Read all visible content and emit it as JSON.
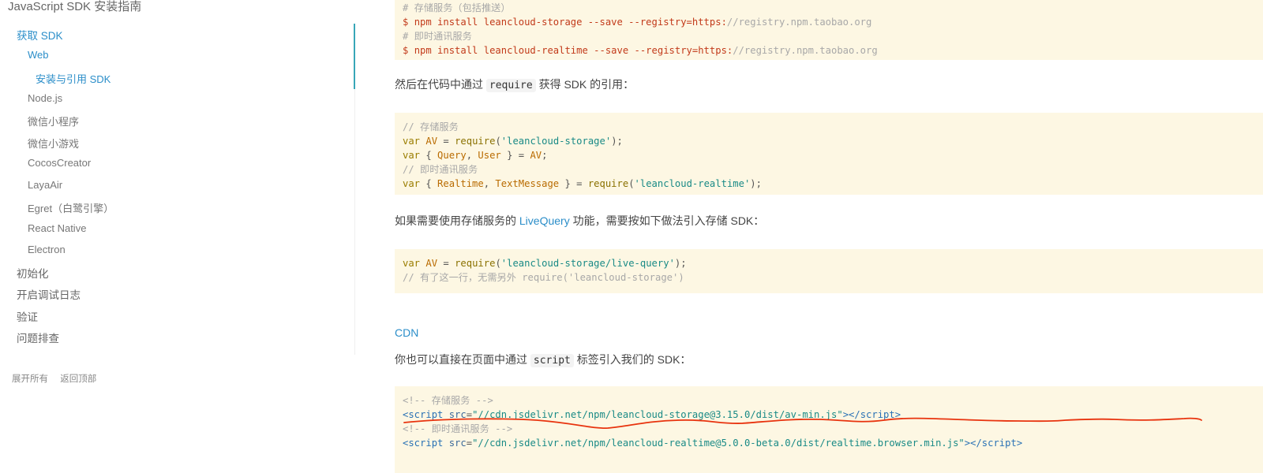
{
  "sidebar": {
    "title": "JavaScript SDK 安装指南",
    "items": [
      {
        "label": "获取 SDK"
      },
      {
        "label": "Web"
      },
      {
        "label": "安装与引用 SDK"
      },
      {
        "label": "Node.js"
      },
      {
        "label": "微信小程序"
      },
      {
        "label": "微信小游戏"
      },
      {
        "label": "CocosCreator"
      },
      {
        "label": "LayaAir"
      },
      {
        "label": "Egret（白鹭引擎）"
      },
      {
        "label": "React Native"
      },
      {
        "label": "Electron"
      },
      {
        "label": "初始化"
      },
      {
        "label": "开启调试日志"
      },
      {
        "label": "验证"
      },
      {
        "label": "问题排查"
      }
    ],
    "footer": {
      "expand_all": "展开所有",
      "back_to_top": "返回顶部"
    }
  },
  "code1": {
    "comment1": "# 存储服务（包括推送）",
    "prompt": "$",
    "cmd1": "npm install leancloud-storage --save --registry=https:",
    "url1": "//registry.npm.taobao.org",
    "comment2": "# 即时通讯服务",
    "cmd2": "npm install leancloud-realtime --save --registry=https:",
    "url2": "//registry.npm.taobao.org"
  },
  "para1": {
    "before": "然后在代码中通过",
    "code": "require",
    "after": "获得 SDK 的引用："
  },
  "code2": {
    "comment1": "// 存储服务",
    "kw": "var",
    "av": "AV",
    "eq": " = ",
    "req": "require",
    "str1": "'leancloud-storage'",
    "end": ");",
    "query": "Query",
    "user": "User",
    "comment2": "// 即时通讯服务",
    "realtime": "Realtime",
    "textmessage": "TextMessage",
    "str2": "'leancloud-realtime'"
  },
  "para2": {
    "before": "如果需要使用存储服务的",
    "link": "LiveQuery",
    "after": "功能，需要按如下做法引入存储 SDK："
  },
  "code3": {
    "str": "'leancloud-storage/live-query'",
    "comment": "// 有了这一行，无需另外 require('leancloud-storage')"
  },
  "cdn_heading": "CDN",
  "para3": {
    "before": "你也可以直接在页面中通过",
    "code": "script",
    "after": "标签引入我们的 SDK："
  },
  "code4": {
    "comment1": "<!-- 存储服务 -->",
    "tag": "script",
    "attr": "src",
    "url1": "\"//cdn.jsdelivr.net/npm/leancloud-storage@3.15.0/dist/av-min.js\"",
    "comment2": "<!-- 即时通讯服务 -->",
    "url2": "\"//cdn.jsdelivr.net/npm/leancloud-realtime@5.0.0-beta.0/dist/realtime.browser.min.js\""
  },
  "colors": {
    "accent": "#2b8ec9",
    "code_bg": "#fdf7e3",
    "annotation": "#e8330e"
  }
}
